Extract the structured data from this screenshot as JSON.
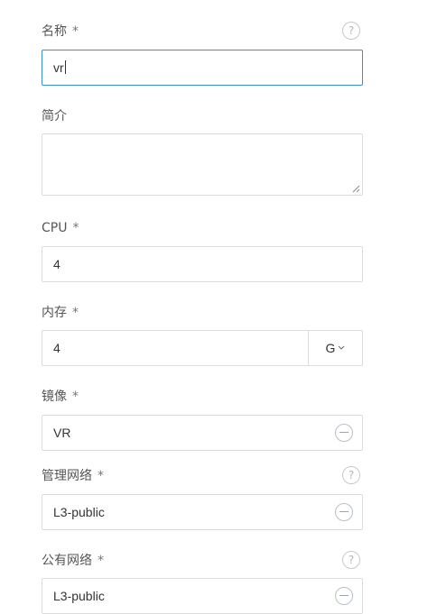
{
  "form": {
    "name": {
      "label": "名称",
      "required_mark": "*",
      "help_icon": "?",
      "value": "vr"
    },
    "description": {
      "label": "简介",
      "value": ""
    },
    "cpu": {
      "label": "CPU",
      "required_mark": "*",
      "value": "4"
    },
    "memory": {
      "label": "内存",
      "required_mark": "*",
      "value": "4",
      "unit": "G",
      "unit_icon": "chevron-down-icon"
    },
    "image": {
      "label": "镜像",
      "required_mark": "*",
      "value": "VR",
      "action_icon": "remove-circle-icon"
    },
    "management_network": {
      "label": "管理网络",
      "required_mark": "*",
      "help_icon": "?",
      "value": "L3-public",
      "action_icon": "remove-circle-icon"
    },
    "public_network": {
      "label": "公有网络",
      "required_mark": "*",
      "help_icon": "?",
      "value": "L3-public",
      "action_icon": "remove-circle-icon"
    }
  },
  "colors": {
    "focus_border": "#3a8ee6",
    "border": "#dcdcdc",
    "label": "#555555"
  }
}
